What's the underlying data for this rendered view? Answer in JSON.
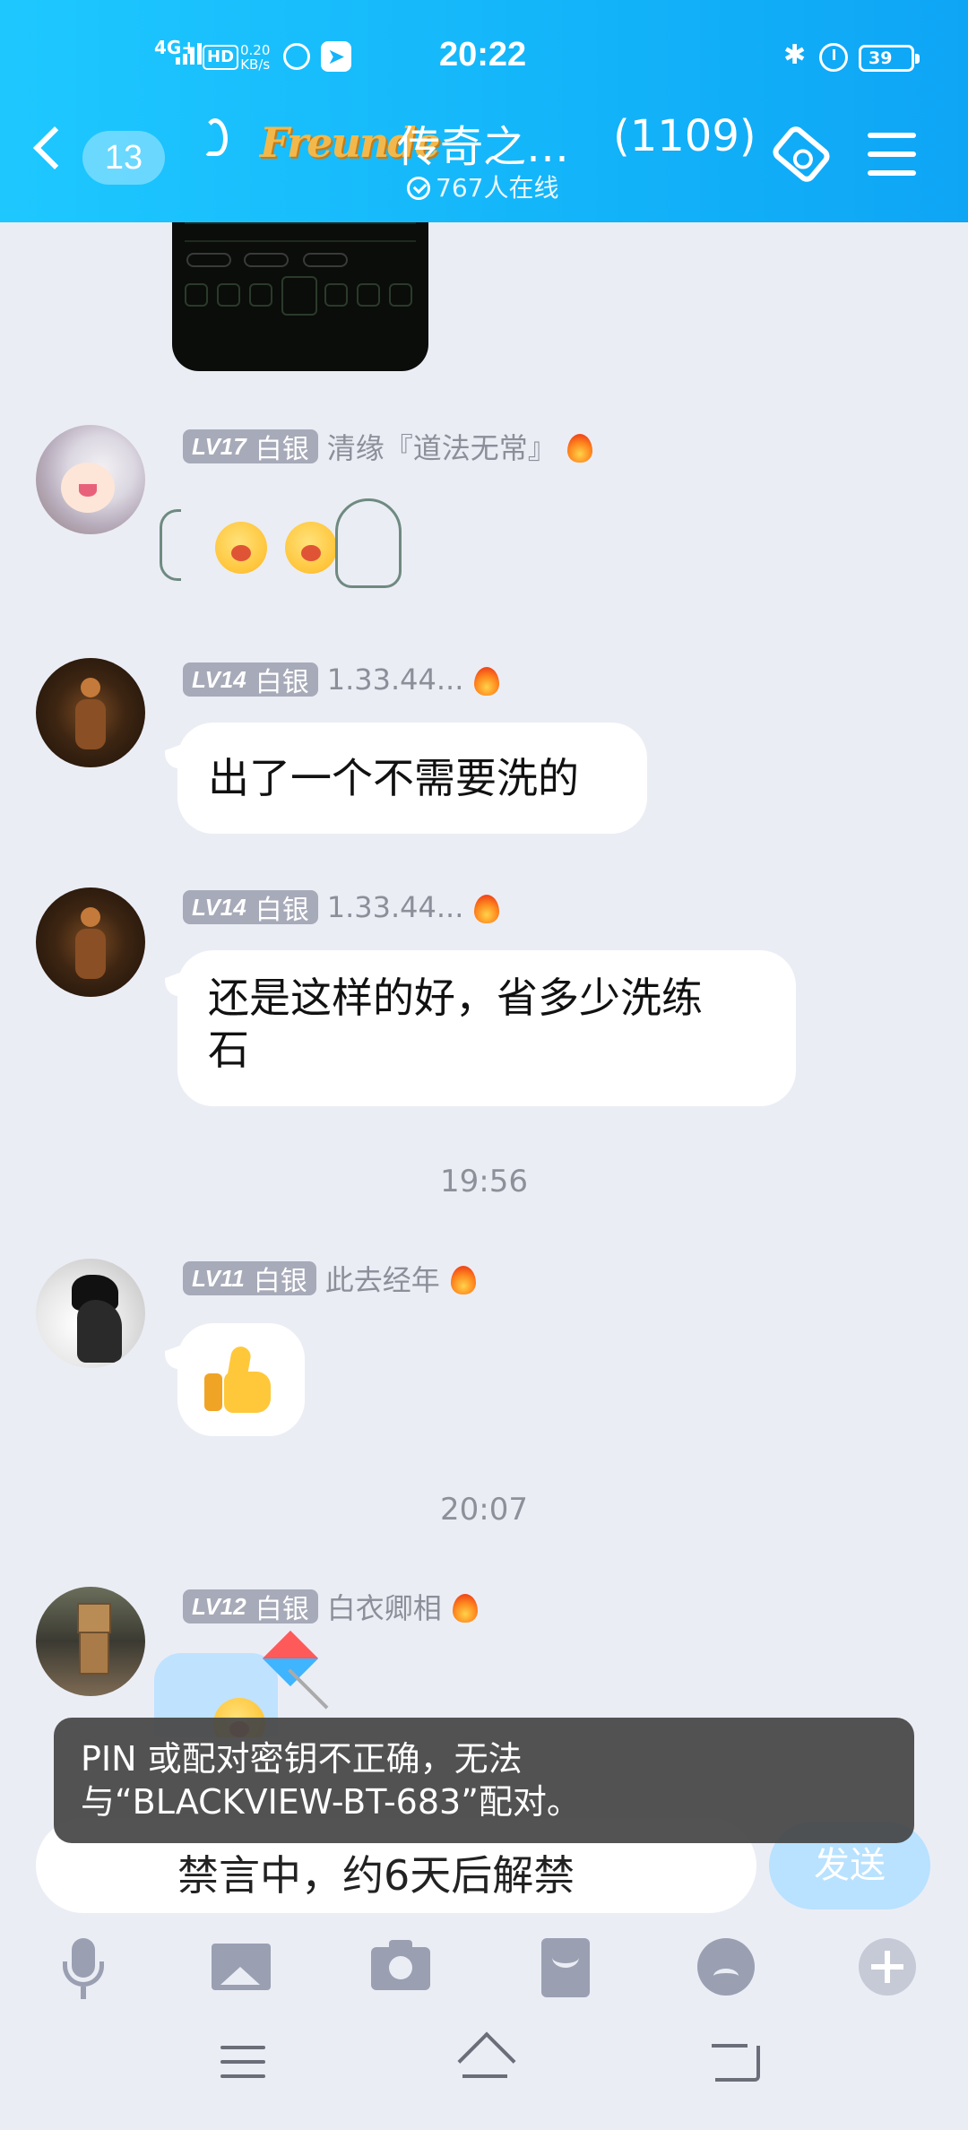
{
  "status_bar": {
    "network": "4G+",
    "hd": "HD",
    "speed_value": "0.20",
    "speed_unit": "KB/s",
    "time": "20:22",
    "battery": "39"
  },
  "header": {
    "unread_count": "13",
    "logo_text": "Freunde",
    "group_title": "传奇之…",
    "member_count": "(1109)",
    "online_status": "767人在线"
  },
  "messages": [
    {
      "level": "LV17",
      "rank": "白银",
      "name": "清缘『道法无常』",
      "type": "sticker"
    },
    {
      "level": "LV14",
      "rank": "白银",
      "name": "1.33.44...",
      "text": "出了一个不需要洗的"
    },
    {
      "level": "LV14",
      "rank": "白银",
      "name": "1.33.44...",
      "text_line1": "还是这样的好，省多少洗练",
      "text_line2": "石"
    },
    {
      "level": "LV11",
      "rank": "白银",
      "name": "此去经年",
      "type": "thumbs-up"
    },
    {
      "level": "LV12",
      "rank": "白银",
      "name": "白衣卿相",
      "type": "sticker"
    }
  ],
  "timestamps": [
    "19:56",
    "20:07"
  ],
  "toast": {
    "line1": "PIN 或配对密钥不正确，无法",
    "line2": "与“BLACKVIEW-BT-683”配对。"
  },
  "input": {
    "muted_text": "禁言中，约6天后解禁",
    "send_label": "发送"
  },
  "colors": {
    "header_gradient_start": "#1ec8ff",
    "header_gradient_end": "#0ea5f5",
    "chat_background": "#ebedf5",
    "level_badge": "#a7aab8",
    "toast_background": "#464646"
  }
}
